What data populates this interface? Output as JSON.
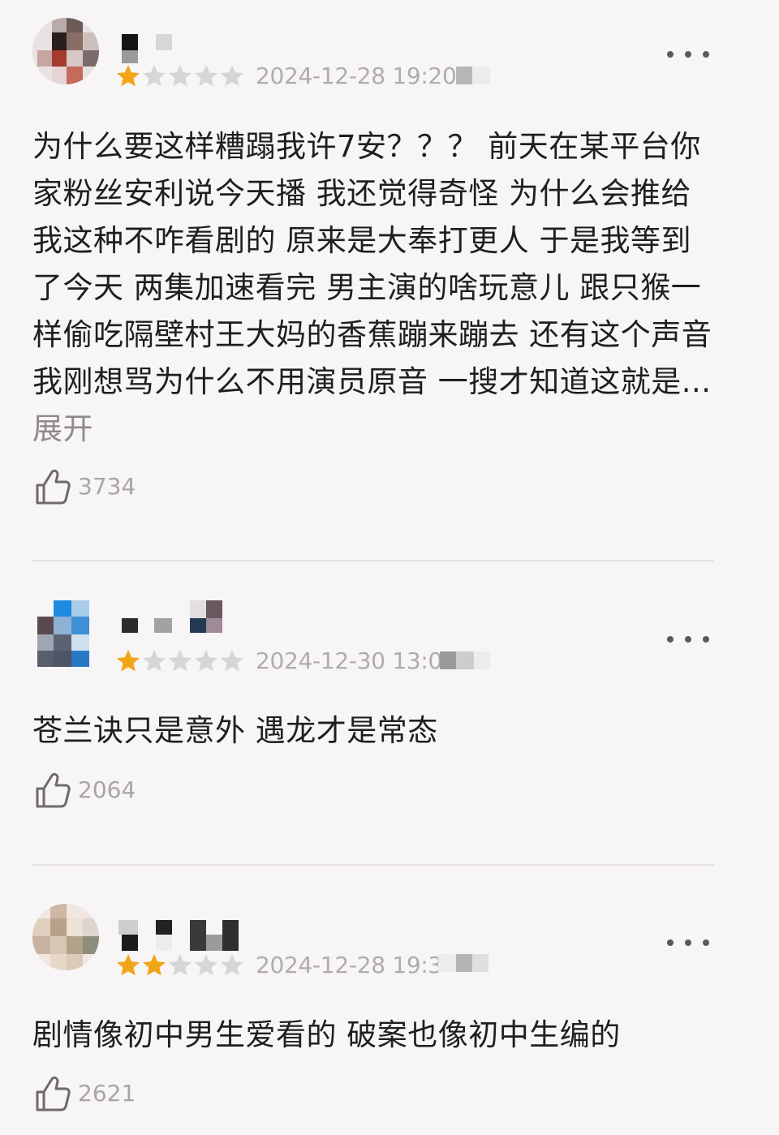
{
  "colors": {
    "background": "#f8f5f6",
    "star_filled": "#f2a516",
    "star_empty": "#d8d5d6",
    "meta_text": "#b0acae",
    "body_text": "#1f1f1f",
    "expand_link": "#8e8a8c"
  },
  "comments": [
    {
      "timestamp": "2024-12-28 19:20",
      "rating": 1,
      "body": "为什么要这样糟蹋我许7安？？？ 前天在某平台你家粉丝安利说今天播 我还觉得奇怪 为什么会推给我这种不咋看剧的 原来是大奉打更人 于是我等到了今天 两集加速看完 男主演的啥玩意儿 跟只猴一样偷吃隔壁村王大妈的香蕉蹦来蹦去 还有这个声音 我刚想骂为什么不用演员原音 一搜才知道这就是...",
      "expand_label": "展开",
      "likes": "3734",
      "icons": {
        "more": "more-dots-icon",
        "like": "thumbs-up-icon"
      }
    },
    {
      "timestamp": "2024-12-30 13:07",
      "rating": 1,
      "body": "苍兰诀只是意外 遇龙才是常态",
      "likes": "2064",
      "icons": {
        "more": "more-dots-icon",
        "like": "thumbs-up-icon"
      }
    },
    {
      "timestamp": "2024-12-28 19:3",
      "rating": 2,
      "body": "剧情像初中男生爱看的 破案也像初中生编的",
      "likes": "2621",
      "icons": {
        "more": "more-dots-icon",
        "like": "thumbs-up-icon"
      }
    }
  ]
}
